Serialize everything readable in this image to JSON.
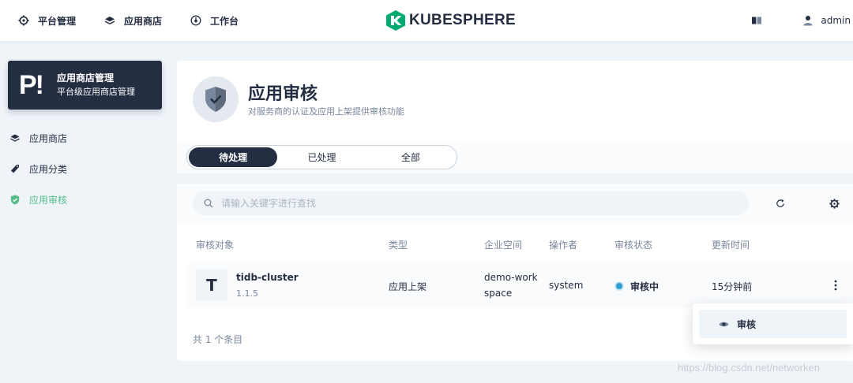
{
  "topbar": {
    "nav": [
      {
        "label": "平台管理",
        "icon": "gear-icon"
      },
      {
        "label": "应用商店",
        "icon": "layers-icon"
      },
      {
        "label": "工作台",
        "icon": "dashboard-icon"
      }
    ],
    "logo_text": "KUBESPHERE",
    "user": "admin",
    "brand_color": "#00a971"
  },
  "sidebar": {
    "card_badge": "P!",
    "card_title": "应用商店管理",
    "card_subtitle": "平台级应用商店管理",
    "items": [
      {
        "label": "应用商店",
        "icon": "layers-icon"
      },
      {
        "label": "应用分类",
        "icon": "tag-icon"
      },
      {
        "label": "应用审核",
        "icon": "shield-icon",
        "active": true
      }
    ],
    "active_color": "#55bc8a"
  },
  "header": {
    "title": "应用审核",
    "description": "对服务商的认证及应用上架提供审核功能"
  },
  "tabs": [
    {
      "label": "待处理",
      "active": true
    },
    {
      "label": "已处理"
    },
    {
      "label": "全部"
    }
  ],
  "search": {
    "placeholder": "请输入关键字进行查找"
  },
  "table": {
    "columns": [
      "审核对象",
      "类型",
      "企业空间",
      "操作者",
      "审核状态",
      "更新时间"
    ],
    "rows": [
      {
        "avatar": "T",
        "name": "tidb-cluster",
        "version": "1.1.5",
        "type": "应用上架",
        "workspace_line1": "demo-work",
        "workspace_line2": "space",
        "operator": "system",
        "status": "审核中",
        "status_color": "#329dce",
        "updated": "15分钟前"
      }
    ],
    "total": "共 1 个条目"
  },
  "dropdown": {
    "items": [
      {
        "label": "审核",
        "icon": "eye-icon"
      }
    ]
  },
  "watermark": "https://blog.csdn.net/networken"
}
